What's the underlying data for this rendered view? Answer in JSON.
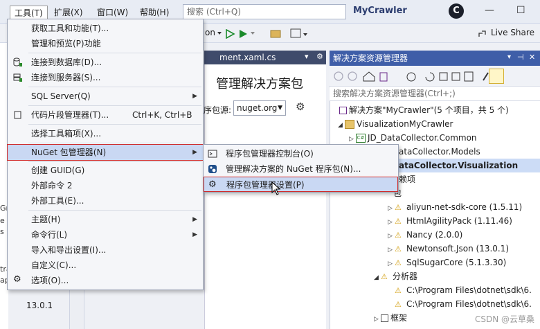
{
  "menubar": {
    "items": [
      "工具(T)",
      "扩展(X)",
      "窗口(W)",
      "帮助(H)"
    ],
    "search_placeholder": "搜索 (Ctrl+Q)",
    "app_name": "MyCrawler",
    "avatar": "C",
    "minimize": "—",
    "maximize": "☐"
  },
  "toolbar": {
    "run_label": "on",
    "live_share": "Live Share"
  },
  "doc": {
    "tab_label": "ment.xaml.cs",
    "heading": "管理解决方案包",
    "source_label": "序包源:",
    "source_value": "nuget.org"
  },
  "left_fragments": [
    "Gr",
    "e",
    "s",
    "tra",
    "ap"
  ],
  "left_version": "13.0.1",
  "tools_menu": {
    "items": [
      {
        "label": "获取工具和功能(T)...",
        "shortcut": "",
        "sub": false
      },
      {
        "label": "管理和预览(P)功能",
        "shortcut": "",
        "sub": false
      },
      {
        "label": "连接到数据库(D)...",
        "shortcut": "",
        "sub": false
      },
      {
        "label": "连接到服务器(S)...",
        "shortcut": "",
        "sub": false
      },
      {
        "label": "SQL Server(Q)",
        "shortcut": "",
        "sub": true
      },
      {
        "label": "代码片段管理器(T)...",
        "shortcut": "Ctrl+K, Ctrl+B",
        "sub": false
      },
      {
        "label": "选择工具箱项(X)...",
        "shortcut": "",
        "sub": false
      },
      {
        "label": "NuGet 包管理器(N)",
        "shortcut": "",
        "sub": true
      },
      {
        "label": "创建 GUID(G)",
        "shortcut": "",
        "sub": false
      },
      {
        "label": "外部命令 2",
        "shortcut": "",
        "sub": false
      },
      {
        "label": "外部工具(E)...",
        "shortcut": "",
        "sub": false
      },
      {
        "label": "主题(H)",
        "shortcut": "",
        "sub": true
      },
      {
        "label": "命令行(L)",
        "shortcut": "",
        "sub": true
      },
      {
        "label": "导入和导出设置(I)...",
        "shortcut": "",
        "sub": false
      },
      {
        "label": "自定义(C)...",
        "shortcut": "",
        "sub": false
      },
      {
        "label": "选项(O)...",
        "shortcut": "",
        "sub": false
      }
    ]
  },
  "nuget_submenu": {
    "items": [
      "程序包管理器控制台(O)",
      "管理解决方案的 NuGet 程序包(N)...",
      "程序包管理器设置(P)"
    ]
  },
  "solution_explorer": {
    "title": "解决方案资源管理器",
    "search_placeholder": "搜索解决方案资源管理器(Ctrl+;)",
    "tree": [
      "解决方案\"MyCrawler\"(5 个项目，共 5 个)",
      "VisualizationMyCrawler",
      "JD_DataCollector.Common",
      "ataCollector.Models",
      "ataCollector.Visualization",
      "赖项",
      "包",
      "aliyun-net-sdk-core (1.5.11)",
      "HtmlAgilityPack (1.11.46)",
      "Nancy (2.0.0)",
      "Newtonsoft.Json (13.0.1)",
      "SqlSugarCore (5.1.3.30)",
      "分析器",
      "C:\\Program Files\\dotnet\\sdk\\6.",
      "C:\\Program Files\\dotnet\\sdk\\6.",
      "框架"
    ]
  },
  "watermark": "CSDN @云草桑",
  "colors": {
    "accent": "#3f5ea8",
    "highlight": "#c9d8f3",
    "frame_red": "#d02a2a"
  }
}
